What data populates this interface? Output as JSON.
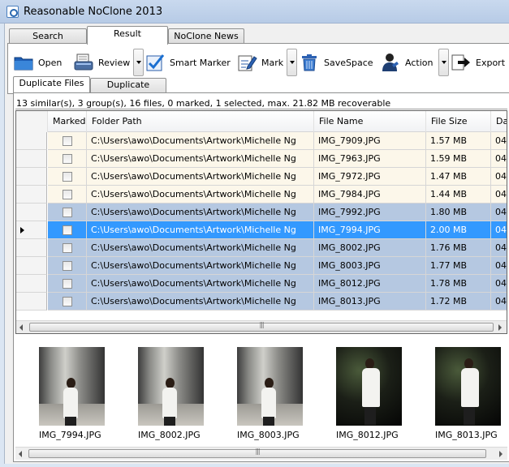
{
  "window": {
    "title": "Reasonable NoClone 2013"
  },
  "top_tabs": [
    {
      "label": "Search",
      "active": false
    },
    {
      "label": "Result",
      "active": true
    },
    {
      "label": "NoClone News",
      "active": false
    }
  ],
  "toolbar": {
    "open": "Open",
    "review": "Review",
    "smart_marker": "Smart Marker",
    "mark": "Mark",
    "savespace": "SaveSpace",
    "action": "Action",
    "export": "Export"
  },
  "sub_tabs": [
    {
      "label": "Duplicate Files",
      "active": true
    },
    {
      "label": "Duplicate Folders",
      "active": false
    }
  ],
  "status": "13 similar(s), 3 group(s), 16 files, 0 marked, 1 selected, max. 21.82 MB recoverable",
  "grid": {
    "columns": [
      "Marked",
      "Folder Path",
      "File Name",
      "File Size",
      "Da"
    ],
    "rows": [
      {
        "path": "C:\\Users\\awo\\Documents\\Artwork\\Michelle Ng",
        "name": "IMG_7909.JPG",
        "size": "1.57 MB",
        "date": "04/",
        "group": "a",
        "selected": false
      },
      {
        "path": "C:\\Users\\awo\\Documents\\Artwork\\Michelle Ng",
        "name": "IMG_7963.JPG",
        "size": "1.59 MB",
        "date": "04/",
        "group": "a",
        "selected": false
      },
      {
        "path": "C:\\Users\\awo\\Documents\\Artwork\\Michelle Ng",
        "name": "IMG_7972.JPG",
        "size": "1.47 MB",
        "date": "04/",
        "group": "a",
        "selected": false
      },
      {
        "path": "C:\\Users\\awo\\Documents\\Artwork\\Michelle Ng",
        "name": "IMG_7984.JPG",
        "size": "1.44 MB",
        "date": "04/",
        "group": "a",
        "selected": false
      },
      {
        "path": "C:\\Users\\awo\\Documents\\Artwork\\Michelle Ng",
        "name": "IMG_7992.JPG",
        "size": "1.80 MB",
        "date": "04/",
        "group": "b",
        "selected": false
      },
      {
        "path": "C:\\Users\\awo\\Documents\\Artwork\\Michelle Ng",
        "name": "IMG_7994.JPG",
        "size": "2.00 MB",
        "date": "04/",
        "group": "b",
        "selected": true
      },
      {
        "path": "C:\\Users\\awo\\Documents\\Artwork\\Michelle Ng",
        "name": "IMG_8002.JPG",
        "size": "1.76 MB",
        "date": "04/",
        "group": "b",
        "selected": false
      },
      {
        "path": "C:\\Users\\awo\\Documents\\Artwork\\Michelle Ng",
        "name": "IMG_8003.JPG",
        "size": "1.77 MB",
        "date": "04/",
        "group": "b",
        "selected": false
      },
      {
        "path": "C:\\Users\\awo\\Documents\\Artwork\\Michelle Ng",
        "name": "IMG_8012.JPG",
        "size": "1.78 MB",
        "date": "04/",
        "group": "b",
        "selected": false
      },
      {
        "path": "C:\\Users\\awo\\Documents\\Artwork\\Michelle Ng",
        "name": "IMG_8013.JPG",
        "size": "1.72 MB",
        "date": "04/",
        "group": "b",
        "selected": false
      }
    ]
  },
  "thumbnails": [
    {
      "label": "IMG_7994.JPG",
      "scene": "light"
    },
    {
      "label": "IMG_8002.JPG",
      "scene": "light"
    },
    {
      "label": "IMG_8003.JPG",
      "scene": "light"
    },
    {
      "label": "IMG_8012.JPG",
      "scene": "dark"
    },
    {
      "label": "IMG_8013.JPG",
      "scene": "dark"
    }
  ],
  "colors": {
    "group_a_row": "#fcf7ea",
    "group_b_row": "#b5c8e1",
    "selected_row": "#3399ff"
  }
}
